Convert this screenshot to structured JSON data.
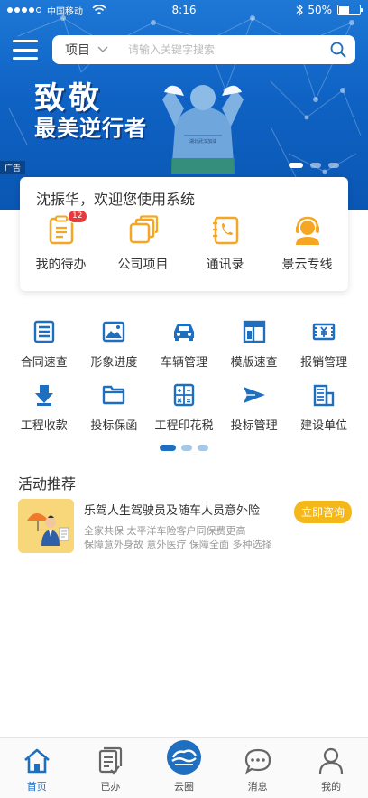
{
  "status_bar": {
    "carrier": "中国移动",
    "time": "8:16",
    "battery": "50%"
  },
  "search": {
    "category": "项目",
    "placeholder": "请输入关键字搜索"
  },
  "banner": {
    "slogan_line1": "致敬",
    "slogan_line2": "最美逆行者",
    "ad_tag": "广告",
    "page_count": 3,
    "active_page": 1
  },
  "welcome": {
    "text": "沈振华，欢迎您使用系统",
    "quick_items": [
      {
        "label": "我的待办",
        "icon": "todo-list-icon",
        "badge": "12"
      },
      {
        "label": "公司项目",
        "icon": "company-project-icon",
        "badge": ""
      },
      {
        "label": "通讯录",
        "icon": "contacts-icon",
        "badge": ""
      },
      {
        "label": "景云专线",
        "icon": "customer-service-icon",
        "badge": ""
      }
    ]
  },
  "functions": {
    "row1": [
      {
        "label": "合同速查",
        "icon": "contract-icon"
      },
      {
        "label": "形象进度",
        "icon": "progress-image-icon"
      },
      {
        "label": "车辆管理",
        "icon": "car-icon"
      },
      {
        "label": "模版速查",
        "icon": "template-icon"
      },
      {
        "label": "报销管理",
        "icon": "reimbursement-icon"
      }
    ],
    "row2": [
      {
        "label": "工程收款",
        "icon": "payment-collection-icon"
      },
      {
        "label": "投标保函",
        "icon": "folder-icon"
      },
      {
        "label": "工程印花税",
        "icon": "tax-calculator-icon"
      },
      {
        "label": "投标管理",
        "icon": "send-icon"
      },
      {
        "label": "建设单位",
        "icon": "building-icon"
      }
    ],
    "page_count": 3,
    "active_page": 1
  },
  "activity": {
    "section_title": "活动推荐",
    "title": "乐驾人生驾驶员及随车人员意外险",
    "desc_line1": "全家共保 太平洋车险客户同保费更高",
    "desc_line2": "保障意外身故 意外医疗 保障全面 多种选择",
    "button": "立即咨询"
  },
  "tabbar": {
    "tabs": [
      {
        "label": "首页",
        "icon": "home-icon"
      },
      {
        "label": "已办",
        "icon": "done-tasks-icon"
      },
      {
        "label": "云圈",
        "icon": "cloud-circle-icon"
      },
      {
        "label": "消息",
        "icon": "message-icon"
      },
      {
        "label": "我的",
        "icon": "profile-icon"
      }
    ],
    "active": "首页"
  },
  "colors": {
    "primary": "#1f6fc0",
    "accent_orange": "#f5a623",
    "button_yellow": "#f5b81b",
    "badge_red": "#e83a3a",
    "banner_blue": "#0f63c4"
  }
}
